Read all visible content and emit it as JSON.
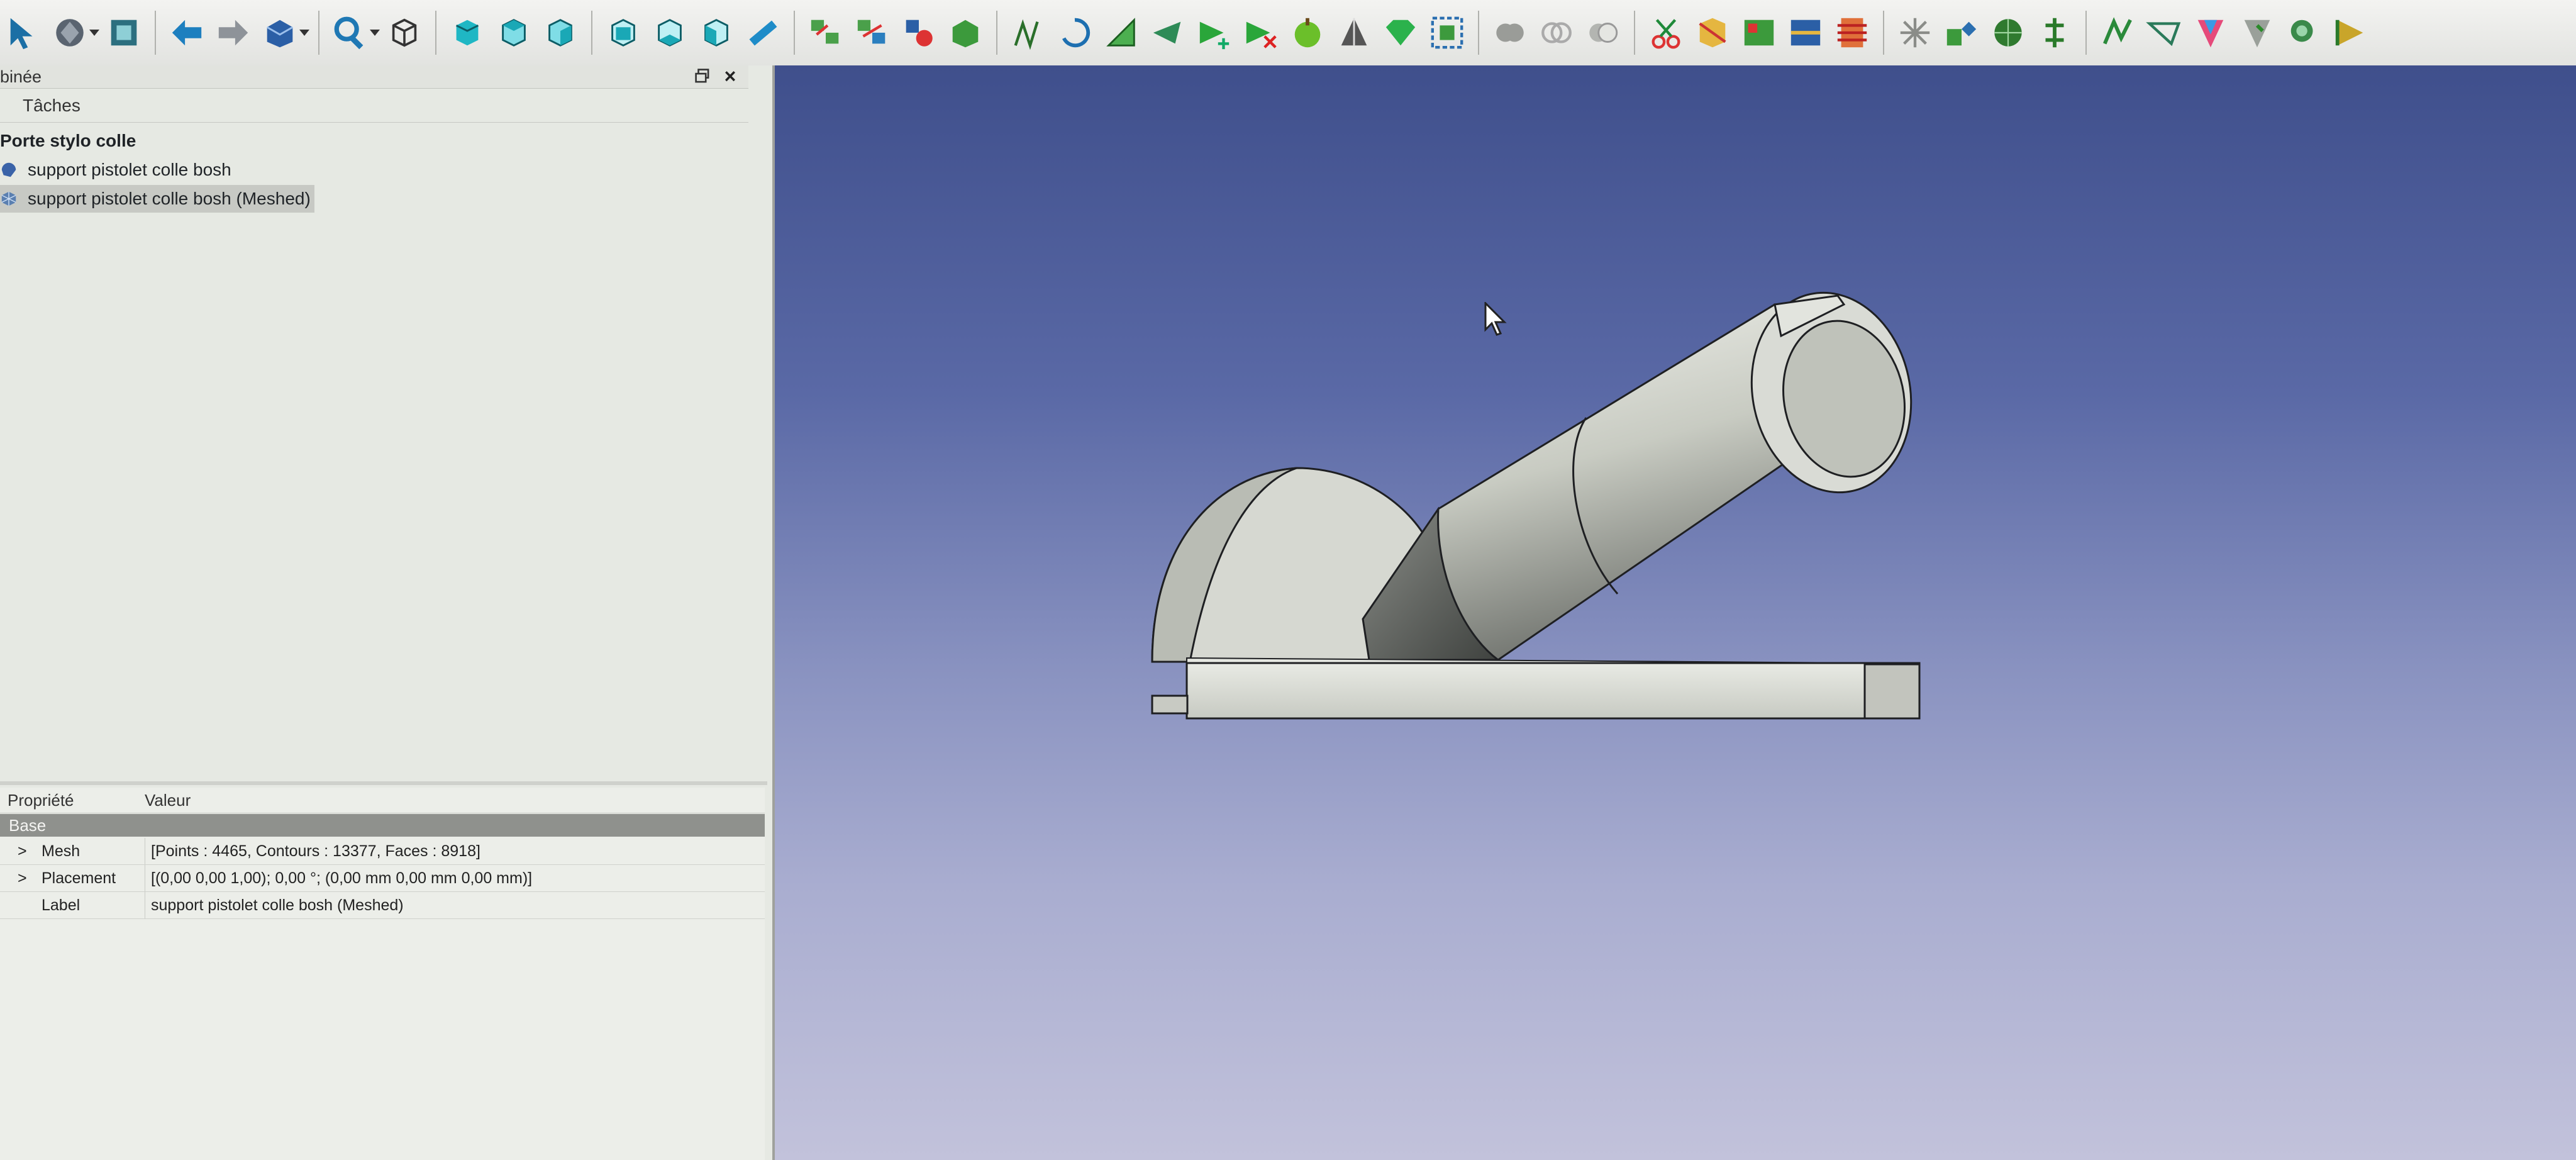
{
  "toolbar": {
    "icons": [
      "select-arrow-icon",
      "std-view-icon",
      "fit-all-icon",
      "back-icon",
      "forward-icon",
      "workbench-icon",
      "zoom-icon",
      "axonometric-icon",
      "front-view-icon",
      "top-view-icon",
      "right-view-icon",
      "rear-view-icon",
      "bottom-view-icon",
      "left-view-icon",
      "measure-icon",
      "mesh-tool-1-icon",
      "mesh-tool-2-icon",
      "mesh-tool-3-icon",
      "mesh-tool-4-icon",
      "mesh-analyze-icon",
      "mesh-harmonize-icon",
      "mesh-evaluate-icon",
      "mesh-fill-icon",
      "mesh-add-icon",
      "mesh-remove-icon",
      "mesh-smooth-icon",
      "mesh-decimate-icon",
      "mesh-solid-icon",
      "mesh-box-icon",
      "boolean-union-icon",
      "boolean-intersect-icon",
      "boolean-diff-icon",
      "cut-icon",
      "trim-icon",
      "segment-icon",
      "section-icon",
      "cross-section-icon",
      "split-icon",
      "merge-icon",
      "sphere-icon",
      "scale-icon",
      "curvature-icon",
      "flatten-icon",
      "paint-icon",
      "color-icon",
      "inspect-icon",
      "unfold-icon"
    ]
  },
  "tree_panel": {
    "title": "binée",
    "tab_label": "Tâches",
    "root_label": "Porte stylo colle",
    "items": [
      {
        "label": "support pistolet colle bosh",
        "icon": "part-icon"
      },
      {
        "label": "support pistolet colle bosh (Meshed)",
        "icon": "mesh-icon"
      }
    ]
  },
  "property_panel": {
    "col_property": "Propriété",
    "col_value": "Valeur",
    "group": "Base",
    "rows": [
      {
        "expand": ">",
        "name": "Mesh",
        "value": "[Points : 4465, Contours : 13377, Faces : 8918]"
      },
      {
        "expand": ">",
        "name": "Placement",
        "value": "[(0,00 0,00 1,00); 0,00 °; (0,00 mm  0,00 mm  0,00 mm)]"
      },
      {
        "expand": "",
        "name": "Label",
        "value": "support pistolet colle bosh (Meshed)"
      }
    ]
  },
  "colors": {
    "toolbar_bg": "#e9eae7",
    "panel_bg": "#e6e9e3",
    "viewport_top": "#3f4f8c",
    "viewport_bottom": "#c2c2db",
    "model_face": "#c9ccc2"
  }
}
